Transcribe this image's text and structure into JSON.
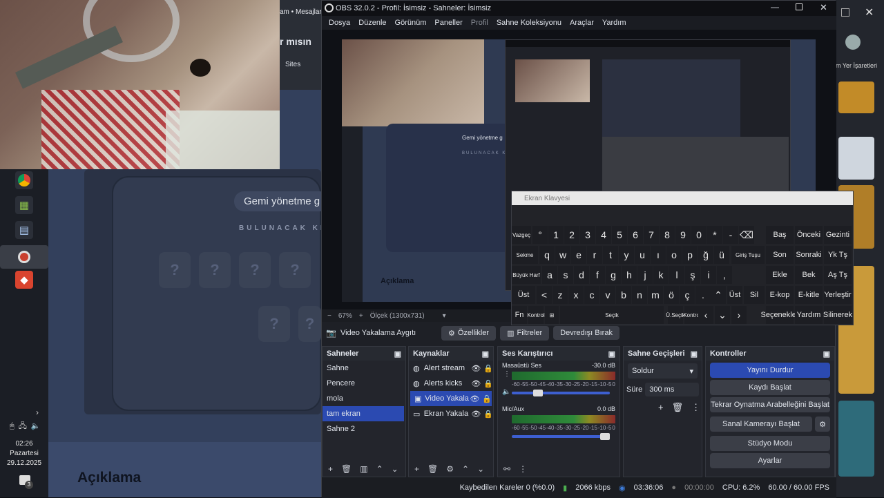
{
  "obs": {
    "title": "OBS 32.0.2 - Profil: İsimsiz - Sahneler: İsimsiz",
    "menu": [
      "Dosya",
      "Düzenle",
      "Görünüm",
      "Paneller",
      "Profil",
      "Sahne Koleksiyonu",
      "Araçlar",
      "Yardım"
    ],
    "zoom": "67%",
    "scale_label": "Ölçek (1300x731)",
    "source_name": "Video Yakalama Aygıtı",
    "source_buttons": {
      "properties": "Özellikler",
      "filters": "Filtreler",
      "deactivate": "Devredışı Bırak"
    },
    "scenes": {
      "title": "Sahneler",
      "items": [
        "Sahne",
        "Pencere",
        "mola",
        "tam ekran",
        "Sahne 2"
      ],
      "selected": "tam ekran"
    },
    "sources": {
      "title": "Kaynaklar",
      "items": [
        "Alert stream",
        "Alerts kicks",
        "Video Yakala",
        "Ekran Yakala"
      ],
      "selected": "Video Yakala"
    },
    "mixer": {
      "title": "Ses Karıştırıcı",
      "channels": [
        {
          "name": "Masaüstü Ses",
          "db": "-30.0 dB",
          "level": 0.27
        },
        {
          "name": "Mic/Aux",
          "db": "0.0 dB",
          "level": 1.0
        }
      ],
      "scale": [
        "-60",
        "-55",
        "-50",
        "-45",
        "-40",
        "-35",
        "-30",
        "-25",
        "-20",
        "-15",
        "-10",
        "-5",
        "0"
      ]
    },
    "transitions": {
      "title": "Sahne Geçişleri",
      "type": "Soldur",
      "duration_label": "Süre",
      "duration": "300 ms"
    },
    "controls": {
      "title": "Kontroller",
      "stop_stream": "Yayını Durdur",
      "start_record": "Kaydı Başlat",
      "replay_buffer": "Tekrar Oynatma Arabelleğini Başlat",
      "virtual_cam": "Sanal Kamerayı Başlat",
      "studio_mode": "Stüdyo Modu",
      "settings": "Ayarlar"
    },
    "status": {
      "dropped": "Kaybedilen Kareler 0 (%0.0)",
      "bitrate": "2066 kbps",
      "stream_time": "03:36:06",
      "rec_time": "00:00:00",
      "cpu": "CPU: 6.2%",
      "fps": "60.00 / 60.00 FPS"
    }
  },
  "background": {
    "game_label": "Gemi yönetme g",
    "hidden_word": "BULUNACAK KE",
    "section": "Açıklama",
    "browser_tab": "am • Mesajlar",
    "browser_text": "r mısın",
    "bookmarks": "Sites",
    "right_label": "m Yer İşaretleri"
  },
  "preview": {
    "section": "Açıklama",
    "game_label": "Gemi yönetme g",
    "hidden_word": "BULUNACAK KE"
  },
  "taskbar": {
    "time": "02:26",
    "day": "Pazartesi",
    "date": "29.12.2025",
    "badge": "3"
  },
  "osk": {
    "title": "Ekran Klavyesi",
    "row1": [
      "Vazgeç",
      "°",
      "1",
      "2",
      "3",
      "4",
      "5",
      "6",
      "7",
      "8",
      "9",
      "0",
      "*",
      "-",
      "⌫"
    ],
    "row2": [
      "Sekme",
      "q",
      "w",
      "e",
      "r",
      "t",
      "y",
      "u",
      "ı",
      "o",
      "p",
      "ğ",
      "ü"
    ],
    "enter": "Giriş Tuşu",
    "row3": [
      "Büyük Harf",
      "a",
      "s",
      "d",
      "f",
      "g",
      "h",
      "j",
      "k",
      "l",
      "ş",
      "i",
      ","
    ],
    "row4": [
      "Üst",
      "<",
      "z",
      "x",
      "c",
      "v",
      "b",
      "n",
      "m",
      "ö",
      "ç",
      "."
    ],
    "row4b": [
      "Üst",
      "Sil"
    ],
    "row5": [
      "Fn",
      "Kontrol",
      "⊞",
      "Seçik",
      "Ü.Seçik",
      "Kontrol"
    ],
    "side": [
      [
        "Baş",
        "Önceki",
        "Gezinti"
      ],
      [
        "Son",
        "Sonraki",
        "Yk Tş"
      ],
      [
        "Ekle",
        "Bek",
        "Aş Tş"
      ],
      [
        "E-kop",
        "E-kitle",
        "Yerleştir"
      ],
      [
        "Seçenekler",
        "Yardım",
        "Silinerek"
      ]
    ]
  }
}
